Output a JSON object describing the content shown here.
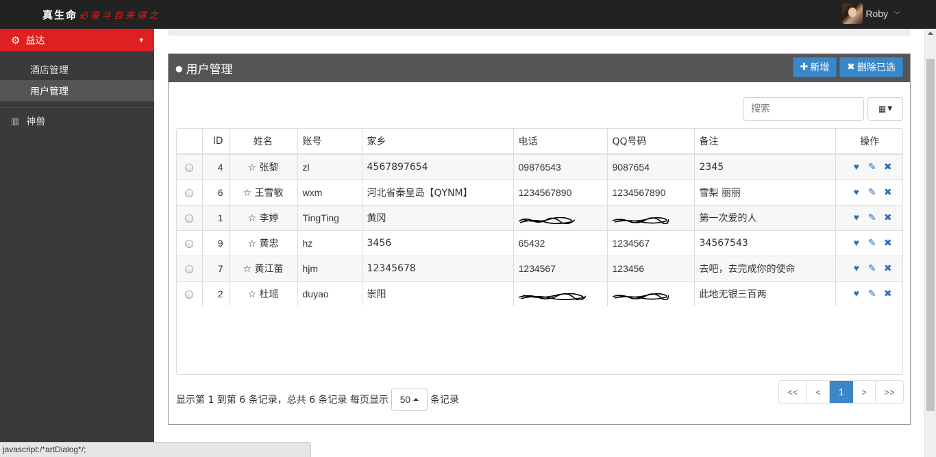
{
  "topbar": {
    "brand": "真生命",
    "slogan": "必奋斗自来得之",
    "user_name": "Roby"
  },
  "sidebar": {
    "group_label": "益达",
    "sub_items": [
      {
        "label": "酒店管理"
      },
      {
        "label": "用户管理"
      }
    ],
    "other_item": "神兽"
  },
  "panel": {
    "title": "用户管理",
    "add_label": "新增",
    "delete_label": "删除已选",
    "search_placeholder": "搜索"
  },
  "table": {
    "headers": [
      "ID",
      "姓名",
      "账号",
      "家乡",
      "电话",
      "QQ号码",
      "备注",
      "操作"
    ],
    "rows": [
      {
        "id": "4",
        "name": "☆ 张黎",
        "account": "zl",
        "hometown": "4567897654",
        "phone": "09876543",
        "qq": "9087654",
        "note": "2345"
      },
      {
        "id": "6",
        "name": "☆ 王雪敏",
        "account": "wxm",
        "hometown": "河北省秦皇岛【QYNM】",
        "phone": "1234567890",
        "qq": "1234567890",
        "note": "雪梨 丽丽"
      },
      {
        "id": "1",
        "name": "☆ 李婷",
        "account": "TingTing",
        "hometown": "黄冈",
        "phone": "",
        "qq": "",
        "note": "第一次爱的人"
      },
      {
        "id": "9",
        "name": "☆ 黄忠",
        "account": "hz",
        "hometown": "3456",
        "phone": "65432",
        "qq": "1234567",
        "note": "34567543"
      },
      {
        "id": "7",
        "name": "☆ 黄江苗",
        "account": "hjm",
        "hometown": "12345678",
        "phone": "1234567",
        "qq": "123456",
        "note": "去吧，去完成你的使命"
      },
      {
        "id": "2",
        "name": "☆ 杜瑶",
        "account": "duyao",
        "hometown": "崇阳",
        "phone": "",
        "qq": "",
        "note": "此地无银三百两"
      }
    ]
  },
  "pagination": {
    "info_prefix": "显示第 1 到第 6 条记录，总共 6 条记录 每页显示",
    "page_size": "50",
    "info_suffix": "条记录",
    "first": "<<",
    "prev": "<",
    "current": "1",
    "next": ">",
    "last": ">>"
  },
  "statusbar": {
    "text": "javascript:/*artDialog*/;"
  },
  "colors": {
    "accent_red": "#e02020",
    "primary_blue": "#3a87c8",
    "topbar": "#222222",
    "sidebar": "#3a3a3a"
  }
}
